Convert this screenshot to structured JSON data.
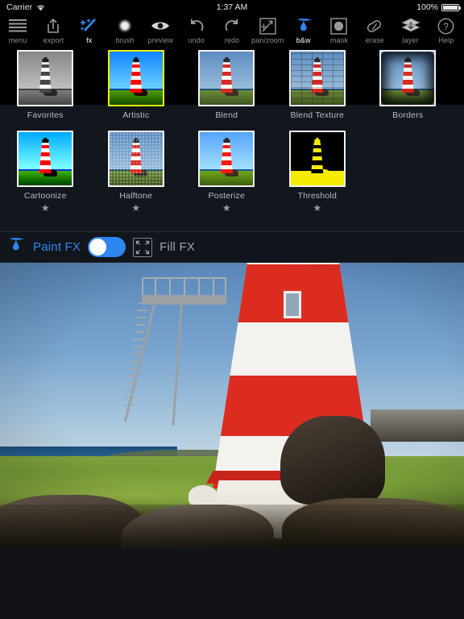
{
  "status_bar": {
    "carrier": "Carrier",
    "wifi_icon": "wifi-icon",
    "time": "1:37 AM",
    "battery_percent": "100%",
    "battery_icon": "battery-full-icon"
  },
  "toolbar": {
    "items": [
      {
        "label": "menu",
        "icon": "hamburger-menu-icon",
        "active": false
      },
      {
        "label": "export",
        "icon": "share-export-icon",
        "active": false
      },
      {
        "label": "fx",
        "icon": "sparkle-wand-icon",
        "active": true
      },
      {
        "label": "brush",
        "icon": "soft-brush-icon",
        "active": false
      },
      {
        "label": "preview",
        "icon": "eye-icon",
        "active": false
      },
      {
        "label": "undo",
        "icon": "undo-arrow-icon",
        "active": false
      },
      {
        "label": "redo",
        "icon": "redo-arrow-icon",
        "active": false
      },
      {
        "label": "pan/zoom",
        "icon": "pan-zoom-icon",
        "active": false
      },
      {
        "label": "b&w",
        "icon": "paint-droplet-icon",
        "active": true
      },
      {
        "label": "mask",
        "icon": "mask-circle-icon",
        "active": false
      },
      {
        "label": "erase",
        "icon": "eraser-icon",
        "active": false
      },
      {
        "label": "layer",
        "icon": "layers-stack-icon",
        "active": false
      },
      {
        "label": "Help",
        "icon": "question-mark-icon",
        "active": false
      }
    ]
  },
  "fx_panel": {
    "selected": "Artistic",
    "row1": [
      {
        "name": "Favorites",
        "variant": "gray",
        "starred": false,
        "selected": false
      },
      {
        "name": "Artistic",
        "variant": "artistic",
        "starred": false,
        "selected": true
      },
      {
        "name": "Blend",
        "variant": "plain",
        "starred": false,
        "selected": false
      },
      {
        "name": "Blend Texture",
        "variant": "texture",
        "starred": false,
        "selected": false
      },
      {
        "name": "Borders",
        "variant": "border",
        "starred": false,
        "selected": false
      }
    ],
    "row2": [
      {
        "name": "Cartoonize",
        "variant": "cartoon",
        "starred": true,
        "selected": false
      },
      {
        "name": "Halftone",
        "variant": "halftone",
        "starred": true,
        "selected": false
      },
      {
        "name": "Posterize",
        "variant": "poster",
        "starred": true,
        "selected": false
      },
      {
        "name": "Threshold",
        "variant": "thresh",
        "starred": true,
        "selected": false
      }
    ],
    "star_glyph": "★"
  },
  "fx_bar": {
    "paint_fx_label": "Paint FX",
    "paint_fx_icon": "paint-droplet-icon",
    "paint_fx_enabled": true,
    "fill_fx_label": "Fill FX",
    "fill_fx_icon": "fill-corners-icon"
  },
  "canvas": {
    "image_description": "lighthouse-photo"
  },
  "colors": {
    "accent_blue": "#2e86f0",
    "selection_yellow": "#f2f000",
    "panel_bg": "#141a22",
    "toolbar_bg": "#000000",
    "label_gray": "#b9bcc1"
  }
}
